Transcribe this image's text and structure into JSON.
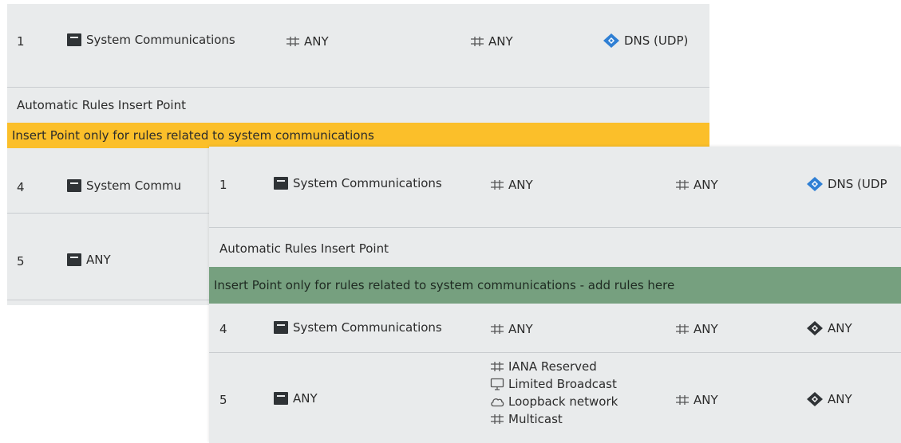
{
  "back": {
    "rows": [
      {
        "num": "1",
        "source": "System Communications",
        "destination": "ANY",
        "destination2": "ANY",
        "service": "DNS (UDP)"
      },
      {
        "num": "4",
        "source": "System Commu"
      },
      {
        "num": "5",
        "source": "ANY"
      }
    ],
    "insert_point_label": "Automatic Rules Insert Point",
    "insert_point_band": "Insert Point only for rules related to system communications"
  },
  "front": {
    "rows": [
      {
        "num": "1",
        "source": "System Communications",
        "destination": "ANY",
        "destination2": "ANY",
        "service": "DNS (UDP"
      },
      {
        "num": "4",
        "source": "System Communications",
        "destination": "ANY",
        "destination2": "ANY",
        "service": "ANY"
      },
      {
        "num": "5",
        "source": "ANY",
        "destination_list": [
          "IANA Reserved",
          "Limited Broadcast",
          "Loopback network",
          "Multicast"
        ],
        "destination2": "ANY",
        "service": "ANY"
      }
    ],
    "insert_point_label": "Automatic Rules Insert Point",
    "insert_point_band": "Insert Point only for rules related to system communications - add rules here"
  },
  "icons": {
    "system": "system-communications-icon",
    "network": "network-icon",
    "service": "service-icon",
    "host": "host-icon",
    "cloud": "cloud-icon"
  },
  "colors": {
    "panel_bg": "#e9ebec",
    "insert_band_yellow": "#fbbf2a",
    "insert_band_green": "#76a07f",
    "service_icon_blue": "#2f7fd4",
    "separator": "#c9cdd0"
  }
}
